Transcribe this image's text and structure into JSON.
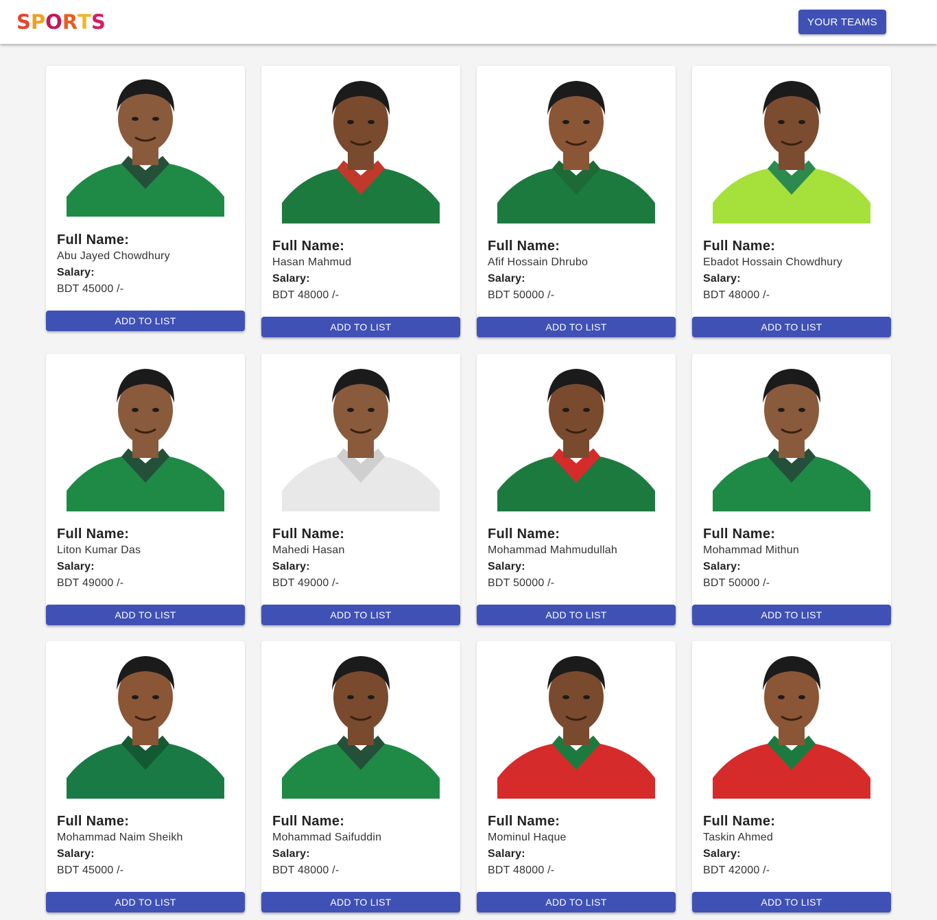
{
  "header": {
    "logo_text": "SPORTS",
    "your_teams_label": "YOUR TEAMS"
  },
  "labels": {
    "full_name": "Full Name:",
    "salary": "Salary:",
    "add_to_list": "ADD TO LIST"
  },
  "players": [
    {
      "name": "Abu Jayed Chowdhury",
      "salary": "BDT 45000 /-",
      "jersey": "#1f8a46",
      "collar": "#24503a",
      "skin": "#8a5a3c"
    },
    {
      "name": "Hasan Mahmud",
      "salary": "BDT 48000 /-",
      "jersey": "#1d7a3f",
      "collar": "#c0392b",
      "skin": "#7a4a2e"
    },
    {
      "name": "Afif Hossain Dhrubo",
      "salary": "BDT 50000 /-",
      "jersey": "#1d7a3f",
      "collar": "#1d6a37",
      "skin": "#8a5636"
    },
    {
      "name": "Ebadot Hossain Chowdhury",
      "salary": "BDT 48000 /-",
      "jersey": "#a6e03a",
      "collar": "#2d8a4e",
      "skin": "#7c4c30"
    },
    {
      "name": "Liton Kumar Das",
      "salary": "BDT 49000 /-",
      "jersey": "#1f8a46",
      "collar": "#24503a",
      "skin": "#8a5a3c"
    },
    {
      "name": "Mahedi Hasan",
      "salary": "BDT 49000 /-",
      "jersey": "#e8e8e8",
      "collar": "#cfcfcf",
      "skin": "#8a5a3c"
    },
    {
      "name": "Mohammad Mahmudullah",
      "salary": "BDT 50000 /-",
      "jersey": "#1d7a3f",
      "collar": "#d62b2b",
      "skin": "#7a4a2e"
    },
    {
      "name": "Mohammad Mithun",
      "salary": "BDT 50000 /-",
      "jersey": "#1f8a46",
      "collar": "#24503a",
      "skin": "#8a5a3c"
    },
    {
      "name": "Mohammad Naim Sheikh",
      "salary": "BDT 45000 /-",
      "jersey": "#1a7a45",
      "collar": "#135a33",
      "skin": "#8a5636"
    },
    {
      "name": "Mohammad Saifuddin",
      "salary": "BDT 48000 /-",
      "jersey": "#1f8a46",
      "collar": "#24503a",
      "skin": "#7a4a2e"
    },
    {
      "name": "Mominul Haque",
      "salary": "BDT 48000 /-",
      "jersey": "#d62b2b",
      "collar": "#1d7a3f",
      "skin": "#7a4a2e"
    },
    {
      "name": "Taskin Ahmed",
      "salary": "BDT 42000 /-",
      "jersey": "#d62b2b",
      "collar": "#1d7a3f",
      "skin": "#8a5636"
    }
  ]
}
